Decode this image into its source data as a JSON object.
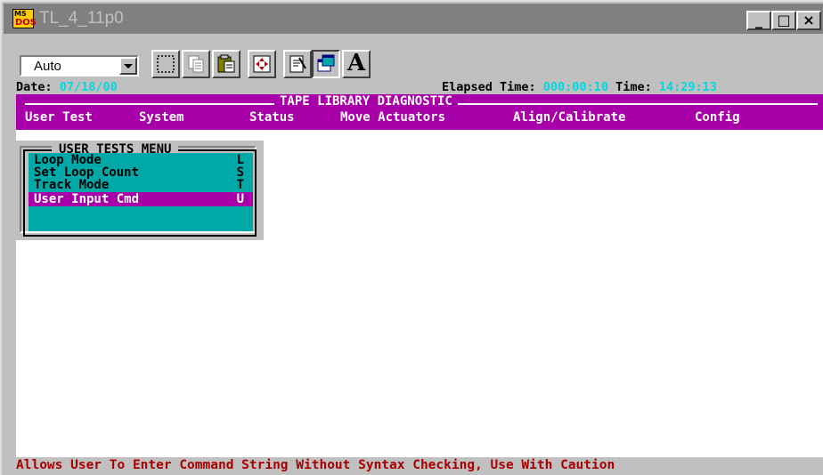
{
  "window": {
    "title": "TL_4_11p0",
    "app_icon": {
      "top": "MS",
      "bottom": "DOS"
    },
    "controls": {
      "minimize": "_",
      "restore": "□",
      "close": "×"
    }
  },
  "toolbar": {
    "font_combo_value": "Auto",
    "tools": [
      "mark-icon",
      "copy-icon",
      "paste-icon",
      "fullscreen-icon",
      "properties-icon",
      "background-icon",
      "font-icon"
    ]
  },
  "dos": {
    "status": {
      "date_label": "Date: ",
      "date_value": "07/18/00",
      "elapsed_label": "Elapsed Time: ",
      "elapsed_value": "000:00:10",
      "time_label": " Time: ",
      "time_value": "14:29:13"
    },
    "menubar": {
      "title": "TAPE LIBRARY DIAGNOSTIC",
      "items": [
        "User Test",
        "System",
        "Status",
        "Move Actuators",
        "Align/Calibrate",
        "Config"
      ]
    },
    "dropdown": {
      "title": "USER TESTS MENU",
      "rows": [
        {
          "label": "Loop Mode",
          "key": "L"
        },
        {
          "label": "Set Loop Count",
          "key": "S"
        },
        {
          "label": "Track Mode",
          "key": "T"
        },
        {
          "label": "User Input Cmd",
          "key": "U"
        }
      ]
    },
    "hint": "Allows User To Enter Command String Without Syntax Checking, Use With Caution"
  },
  "colors": {
    "menu_bg": "#a800a8",
    "list_bg": "#00a8a8",
    "status_highlight": "#00d8e0",
    "hint_text": "#a80000"
  }
}
